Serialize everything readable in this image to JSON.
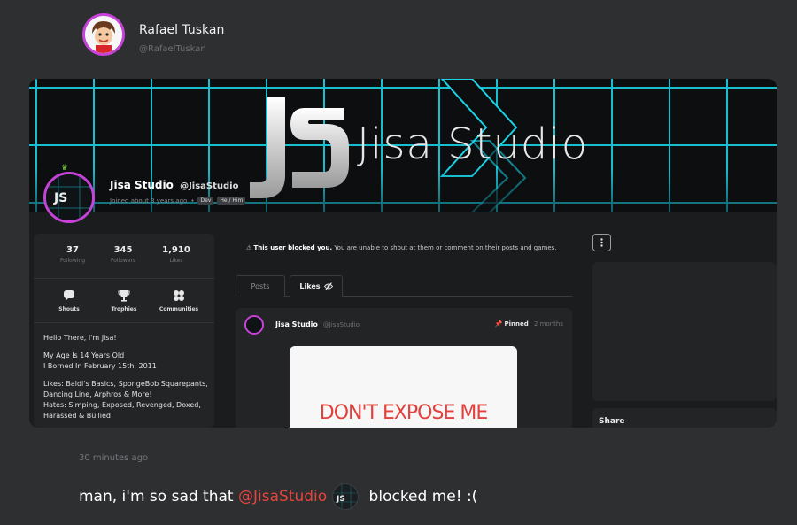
{
  "post": {
    "author_name": "Rafael Tuskan",
    "author_handle": "@RafaelTuskan",
    "timestamp": "30 minutes ago",
    "message_before": "man, i'm so sad that ",
    "mention": "@JisaStudio",
    "message_after": " blocked me! :("
  },
  "screenshot": {
    "banner_title": "Jisa Studio",
    "logo_text": "JS",
    "profile": {
      "name": "Jisa Studio",
      "handle": "@JisaStudio",
      "joined": "Joined about 3 years ago",
      "separator": "•",
      "badges": [
        "Dev",
        "He / Him"
      ]
    },
    "stats": [
      {
        "value": "37",
        "label": "Following"
      },
      {
        "value": "345",
        "label": "Followers"
      },
      {
        "value": "1,910",
        "label": "Likes"
      }
    ],
    "nav": [
      {
        "label": "Shouts",
        "icon": "shouts-icon"
      },
      {
        "label": "Trophies",
        "icon": "trophy-icon"
      },
      {
        "label": "Communities",
        "icon": "communities-icon"
      }
    ],
    "bio": {
      "greeting": "Hello There, I'm Jisa!",
      "age_line": "My Age Is 14 Years Old",
      "born_line": "I Borned In February 15th, 2011",
      "likes_line": "Likes: Baldi's Basics, SpongeBob Squarepants, Dancing Line, Arphros & More!",
      "hates_line": "Hates: Simping, Exposed, Revenged, Doxed, Harassed & Bullied!"
    },
    "blocked_notice": {
      "bold": "This user blocked you.",
      "rest": " You are unable to shout at them or comment on their posts and games."
    },
    "tabs": {
      "posts": "Posts",
      "likes": "Likes"
    },
    "pinned_post": {
      "author": "Jisa Studio",
      "handle": "@JisaStudio",
      "pinned_label": "Pinned",
      "age": "2 months",
      "image_text": "DON'T EXPOSE ME"
    },
    "share_label": "Share"
  },
  "colors": {
    "background": "#2d2f31",
    "avatar_ring": "#c642d8",
    "mention": "#e8443d",
    "grid": "#19d3e6"
  }
}
